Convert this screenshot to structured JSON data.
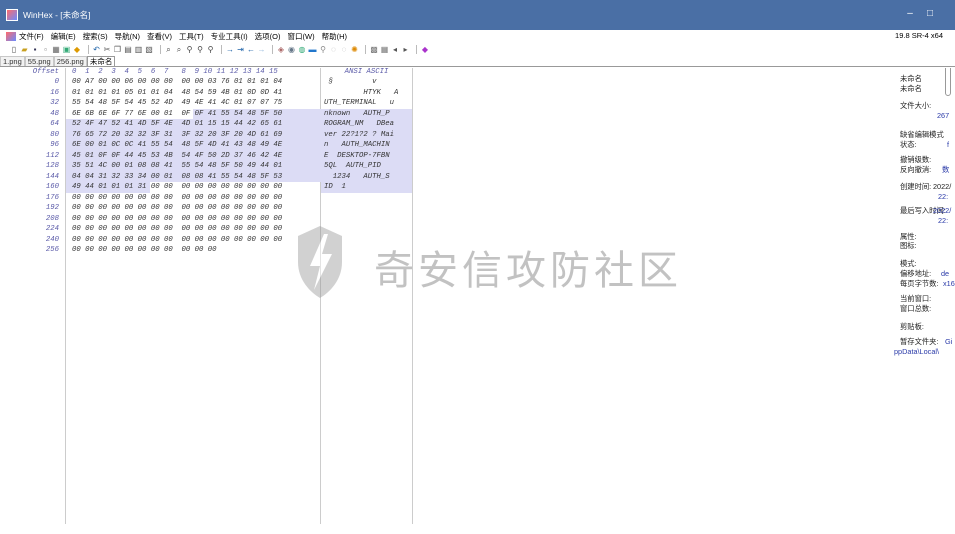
{
  "window": {
    "title": "WinHex - [未命名]",
    "minimize": "–",
    "maximize": "□"
  },
  "menu": {
    "items": [
      "文件(F)",
      "编辑(E)",
      "搜索(S)",
      "导航(N)",
      "查看(V)",
      "工具(T)",
      "专业工具(I)",
      "选项(O)",
      "窗口(W)",
      "帮助(H)"
    ],
    "version": "19.8 SR-4 x64"
  },
  "tabs": [
    "1.png",
    "55.png",
    "256.png",
    "未命名"
  ],
  "editor": {
    "offset_header": "Offset",
    "hex_header": "0  1  2  3  4  5  6  7   8  9 10 11 12 13 14 15",
    "ascii_header": "ANSI ASCII",
    "offsets": [
      "0",
      "16",
      "32",
      "48",
      "64",
      "80",
      "96",
      "112",
      "128",
      "144",
      "160",
      "176",
      "192",
      "208",
      "224",
      "240",
      "256"
    ],
    "hex_rows": [
      "00 A7 00 00 06 00 00 00  00 00 03 76 01 01 01 04",
      "01 01 01 01 05 01 01 04  48 54 59 4B 01 0D 0D 41",
      "55 54 48 5F 54 45 52 4D  49 4E 41 4C 01 07 07 75",
      "6E 6B 6E 6F 77 6E 00 01  0F 0F 41 55 54 48 5F 50",
      "52 4F 47 52 41 4D 5F 4E  4D 01 15 15 44 42 65 61",
      "76 65 72 20 32 32 3F 31  3F 32 20 3F 20 4D 61 69",
      "6E 00 01 0C 0C 41 55 54  48 5F 4D 41 43 48 49 4E",
      "45 01 0F 0F 44 45 53 4B  54 4F 50 2D 37 46 42 4E",
      "35 51 4C 00 01 08 08 41  55 54 48 5F 50 49 44 01",
      "04 04 31 32 33 34 00 01  08 08 41 55 54 48 5F 53",
      "49 44 01 01 01 31 00 00  00 00 00 00 00 00 00 00",
      "00 00 00 00 00 00 00 00  00 00 00 00 00 00 00 00",
      "00 00 00 00 00 00 00 00  00 00 00 00 00 00 00 00",
      "00 00 00 00 00 00 00 00  00 00 00 00 00 00 00 00",
      "00 00 00 00 00 00 00 00  00 00 00 00 00 00 00 00",
      "00 00 00 00 00 00 00 00  00 00 00 00 00 00 00 00",
      "00 00 00 00 00 00 00 00  00 00 00"
    ],
    "ascii_rows": [
      " §         v   ",
      "         HTYK   A",
      "UTH_TERMINAL   u",
      "nknown   AUTH_P",
      "ROGRAM_NM   DBea",
      "ver 22?1?2 ? Mai",
      "n   AUTH_MACHIN",
      "E  DESKTOP-7FBN",
      "5QL  AUTH_PID ",
      "  1234   AUTH_S",
      "ID  1",
      "",
      "",
      "",
      "",
      "",
      ""
    ]
  },
  "watermark": {
    "text": "奇安信攻防社区"
  },
  "info_panel": {
    "name_label": "未命名",
    "name_value": "未命名",
    "filesize_label": "文件大小:",
    "filesize_value": "267",
    "default_mode_label": "缺省编辑模式",
    "state_label": "状态:",
    "state_value": "f",
    "undo_level_label": "撤销级数:",
    "undo_reverse_label": "反向撤消:",
    "undo_reverse_value": "数",
    "created_label": "创建时间:",
    "created_value": "2022/",
    "created_time": "22:",
    "modified_label": "最后写入时间:",
    "modified_value": "2022/",
    "modified_time": "22:",
    "attr_label": "属性:",
    "icon_label": "图标:",
    "mode_label": "模式:",
    "mode_value": "de",
    "offset_label": "偏移地址:",
    "bytes_per_page_label": "每页字节数:",
    "bytes_per_page_value": "x16",
    "cur_window_label": "当前窗口:",
    "window_count_label": "窗口总数:",
    "clipboard_label": "剪贴板:",
    "temp_folder_label": "暂存文件夹:",
    "temp_folder_value": "Gi",
    "temp_path": "ppData\\Local\\"
  }
}
